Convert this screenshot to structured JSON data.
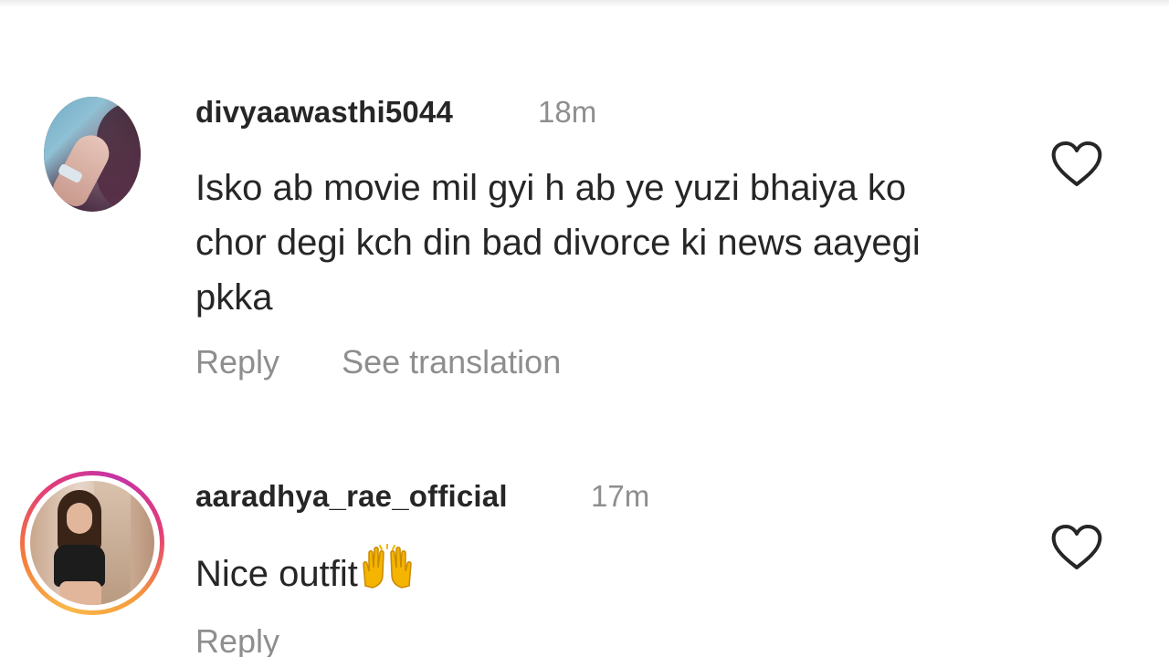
{
  "comments": [
    {
      "username": "divyaawasthi5044",
      "time": "18m",
      "text": "Isko ab movie mil gyi h ab ye yuzi bhaiya ko chor degi kch din bad divorce ki news aayegi pkka",
      "actions": [
        "Reply",
        "See translation"
      ],
      "avatar_icon": "avatar-photo",
      "like_icon": "heart-outline-icon"
    },
    {
      "username": "aaradhya_rae_official",
      "time": "17m",
      "text": "Nice outfit",
      "emoji": "raised-hands-emoji",
      "actions": [
        "Reply"
      ],
      "avatar_icon": "avatar-photo-with-story-ring",
      "like_icon": "heart-outline-icon"
    }
  ],
  "colors": {
    "primary_text": "#262626",
    "secondary_text": "#8e8e8e",
    "story_ring": [
      "#f9b94a",
      "#e33d77",
      "#c533a6"
    ]
  }
}
